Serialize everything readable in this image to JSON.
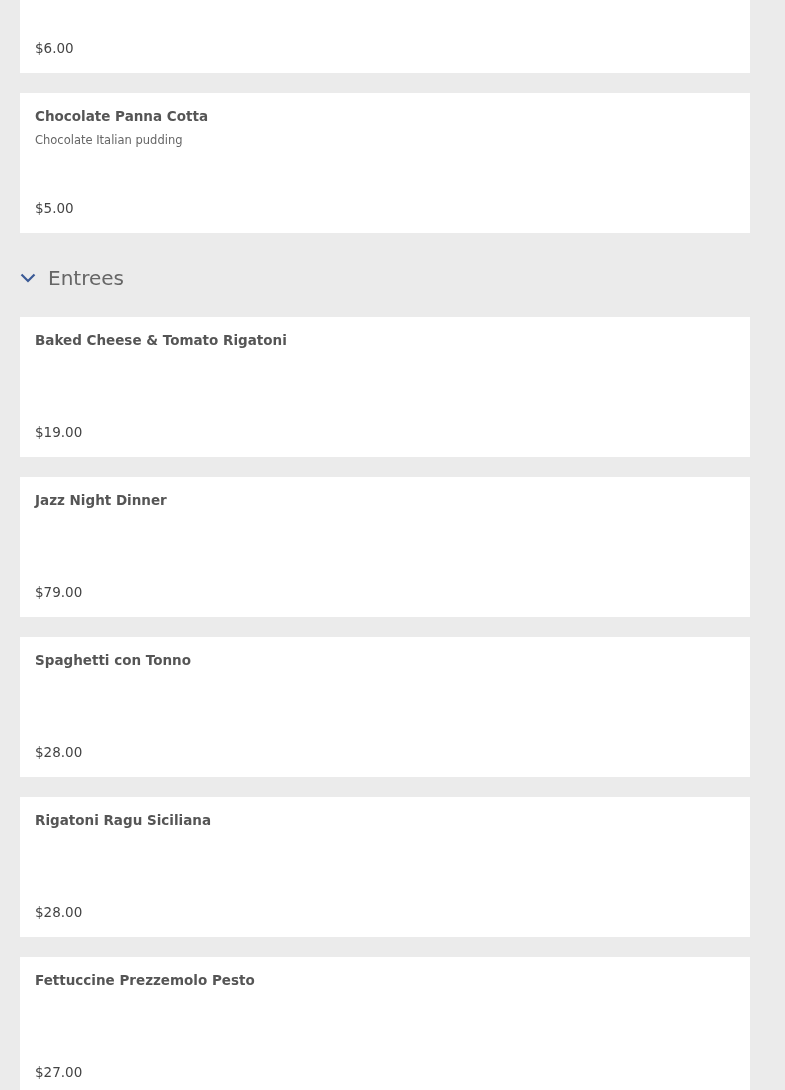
{
  "sections": [
    {
      "items": [
        {
          "price": "$6.00"
        },
        {
          "name": "Chocolate Panna Cotta",
          "description": "Chocolate Italian pudding",
          "price": "$5.00"
        }
      ]
    },
    {
      "title": "Entrees",
      "expanded": true,
      "items": [
        {
          "name": "Baked Cheese & Tomato Rigatoni",
          "price": "$19.00"
        },
        {
          "name": "Jazz Night Dinner",
          "price": "$79.00"
        },
        {
          "name": "Spaghetti con Tonno",
          "price": "$28.00"
        },
        {
          "name": "Rigatoni Ragu Siciliana",
          "price": "$28.00"
        },
        {
          "name": "Fettuccine Prezzemolo Pesto",
          "price": "$27.00"
        }
      ]
    }
  ]
}
